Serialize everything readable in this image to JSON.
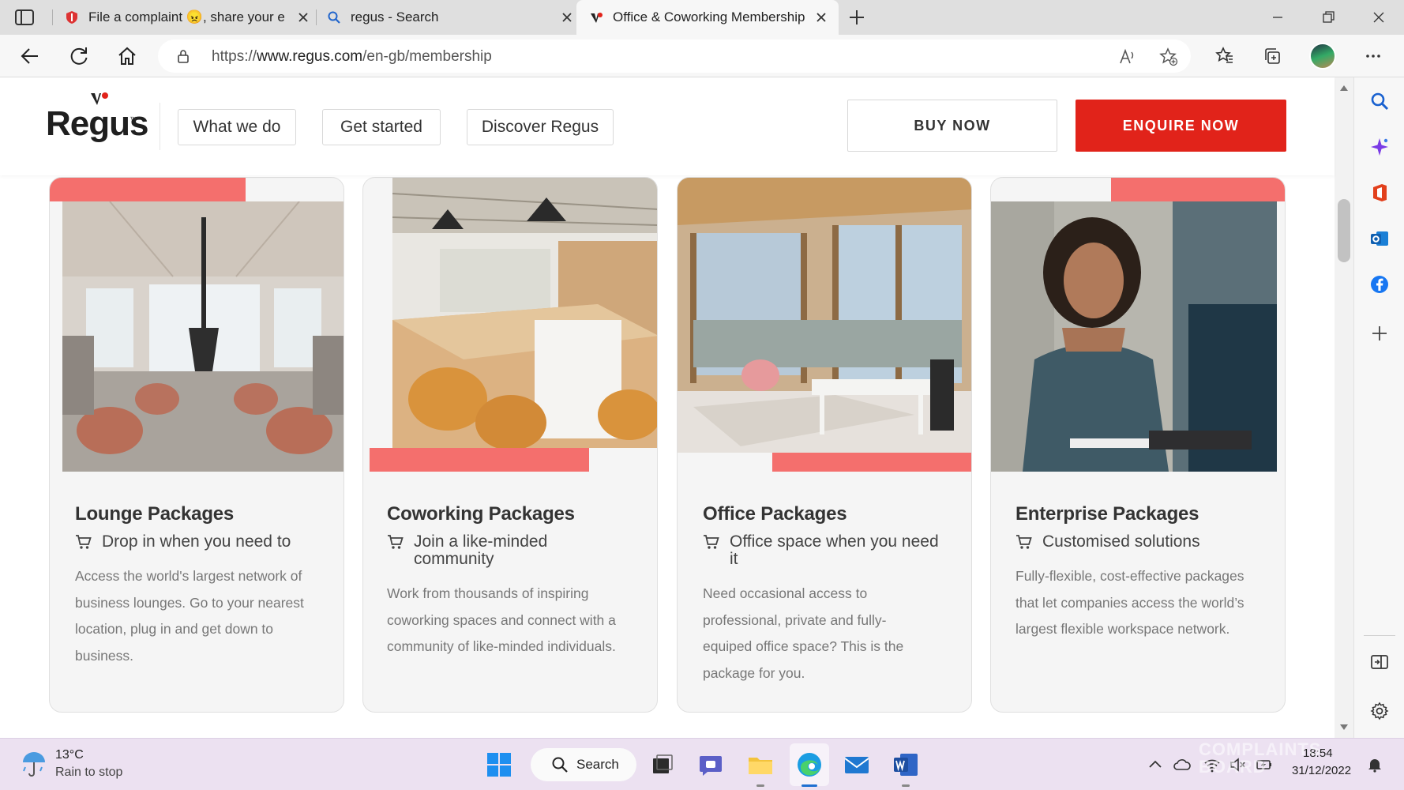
{
  "browser": {
    "tabs": [
      {
        "title": "File a complaint 😠, share your e",
        "active": false
      },
      {
        "title": "regus - Search",
        "active": false
      },
      {
        "title": "Office & Coworking Membership",
        "active": true
      }
    ],
    "url_prefix": "https://",
    "url_domain": "www.regus.com",
    "url_path": "/en-gb/membership"
  },
  "site": {
    "logo": "Regus",
    "logo_tm": "™",
    "nav": [
      "What we do",
      "Get started",
      "Discover Regus"
    ],
    "buy_label": "BUY NOW",
    "enquire_label": "ENQUIRE NOW",
    "accent_color": "#e1231a"
  },
  "cards": [
    {
      "title": "Lounge Packages",
      "subtitle": "Drop in when you need to",
      "description": "Access the world's largest network of business lounges. Go to your nearest location, plug in and get down to business."
    },
    {
      "title": "Coworking Packages",
      "subtitle": "Join a like-minded community",
      "description": "Work from thousands of inspiring coworking spaces and connect with a community of like-minded individuals."
    },
    {
      "title": "Office Packages",
      "subtitle": "Office space when you need it",
      "description": "Need occasional access to professional, private and fully-equiped office space? This is the package for you."
    },
    {
      "title": "Enterprise Packages",
      "subtitle": "Customised solutions",
      "description": "Fully-flexible, cost-effective packages that let companies access the world’s largest flexible workspace network."
    }
  ],
  "taskbar": {
    "temperature": "13°C",
    "weather": "Rain to stop",
    "search_label": "Search",
    "time": "18:54",
    "date": "31/12/2022",
    "watermark": "COMPLAINTS BOARD"
  }
}
